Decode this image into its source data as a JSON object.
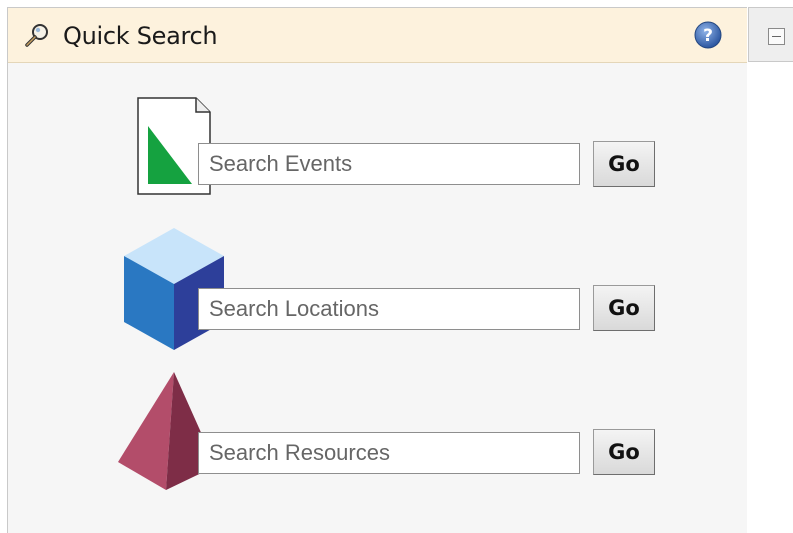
{
  "header": {
    "title": "Quick Search",
    "help_icon": "help-icon",
    "collapse_icon": "collapse-icon"
  },
  "searches": [
    {
      "icon": "events-document-icon",
      "placeholder": "Search Events",
      "button_label": "Go"
    },
    {
      "icon": "locations-cube-icon",
      "placeholder": "Search Locations",
      "button_label": "Go"
    },
    {
      "icon": "resources-pyramid-icon",
      "placeholder": "Search Resources",
      "button_label": "Go"
    }
  ],
  "colors": {
    "header_bg": "#fdf2dd",
    "panel_bg": "#f6f6f6",
    "help_blue": "#3d6bb3",
    "events_green": "#1a9a3c",
    "locations_blue": "#2f7fc8",
    "resources_rose": "#b04a68"
  }
}
